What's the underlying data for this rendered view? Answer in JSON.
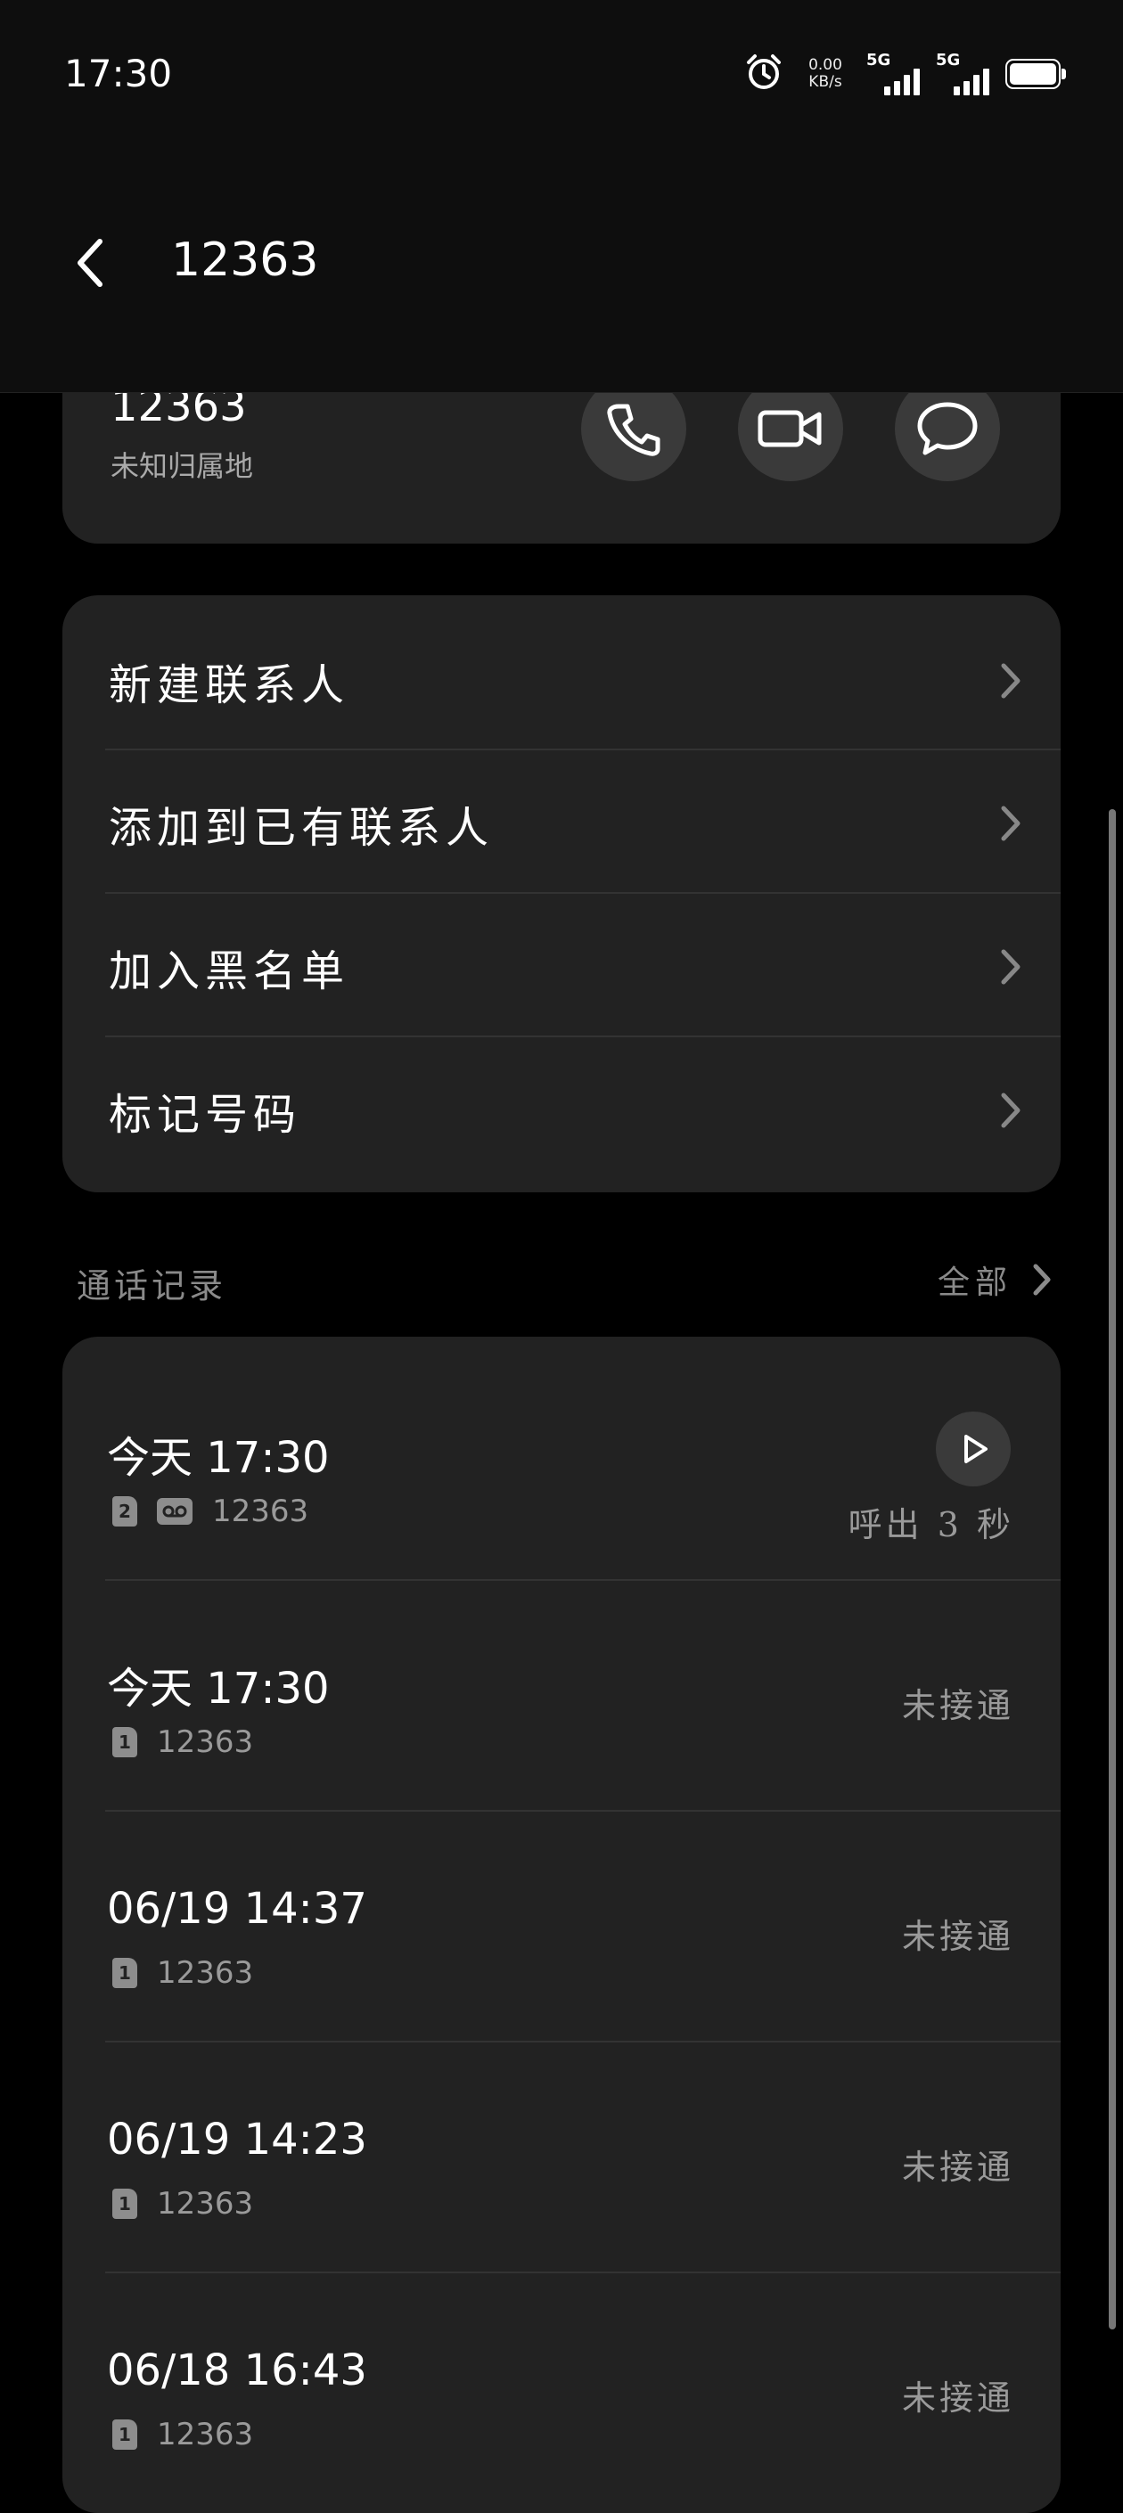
{
  "status_bar": {
    "time": "17:30",
    "net_speed_value": "0.00",
    "net_speed_unit": "KB/s",
    "signal_1_label": "5G",
    "signal_2_label": "5G",
    "icons": [
      "alarm-icon",
      "signal-icon",
      "battery-icon"
    ]
  },
  "header": {
    "title": "12363"
  },
  "contact": {
    "number": "12363",
    "location": "未知归属地",
    "actions": [
      "phone-icon",
      "video-call-icon",
      "message-icon"
    ]
  },
  "menu": {
    "items": [
      {
        "label": "新建联系人"
      },
      {
        "label": "添加到已有联系人"
      },
      {
        "label": "加入黑名单"
      },
      {
        "label": "标记号码"
      }
    ]
  },
  "call_log": {
    "title": "通话记录",
    "all_label": "全部",
    "rows": [
      {
        "when": "今天 17:30",
        "sim": "2",
        "voicemail": true,
        "number": "12363",
        "status": "呼出 3 秒",
        "has_play": true
      },
      {
        "when": "今天 17:30",
        "sim": "1",
        "voicemail": false,
        "number": "12363",
        "status": "未接通",
        "has_play": false
      },
      {
        "when": "06/19 14:37",
        "sim": "1",
        "voicemail": false,
        "number": "12363",
        "status": "未接通",
        "has_play": false
      },
      {
        "when": "06/19 14:23",
        "sim": "1",
        "voicemail": false,
        "number": "12363",
        "status": "未接通",
        "has_play": false
      },
      {
        "when": "06/18 16:43",
        "sim": "1",
        "voicemail": false,
        "number": "12363",
        "status": "未接通",
        "has_play": false
      }
    ]
  },
  "colors": {
    "background": "#000000",
    "header_bg": "#0e0e0e",
    "card_bg": "#222222",
    "button_bg": "#3a3a3a",
    "secondary_text": "#9a9a9a"
  }
}
